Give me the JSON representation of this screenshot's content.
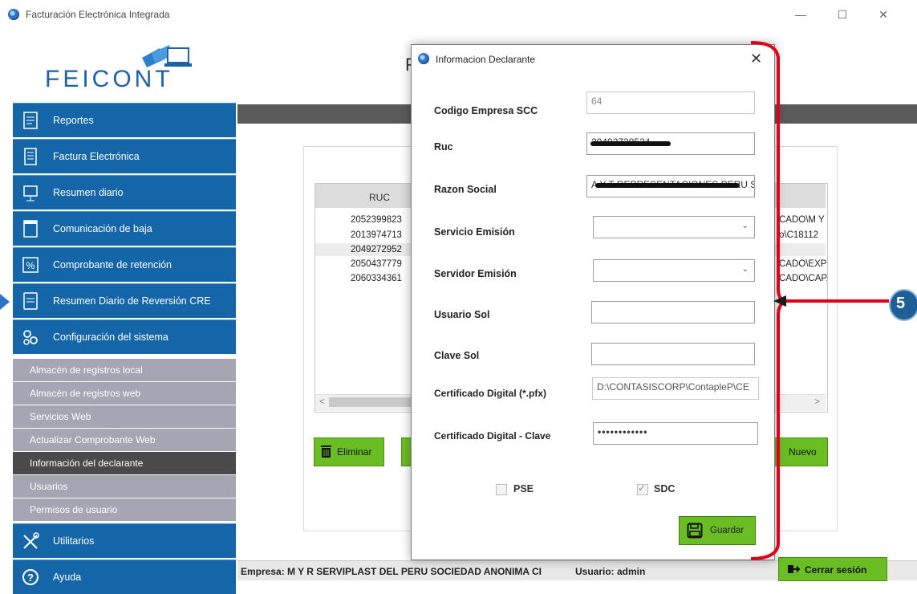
{
  "window": {
    "title": "Facturación Electrónica Integrada",
    "controls": {
      "minimize": "—",
      "maximize": "☐",
      "close": "✕"
    }
  },
  "logo": {
    "text": "FEICONT"
  },
  "sidebar": {
    "items": [
      {
        "label": "Reportes",
        "icon": "report-icon"
      },
      {
        "label": "Factura Electrónica",
        "icon": "document-icon"
      },
      {
        "label": "Resumen diario",
        "icon": "calendar-icon"
      },
      {
        "label": "Comunicación de baja",
        "icon": "list-icon"
      },
      {
        "label": "Comprobante de retención",
        "icon": "percent-icon"
      },
      {
        "label": "Resumen Diario de Reversión CRE",
        "icon": "notebook-icon"
      },
      {
        "label": "Configuración del sistema",
        "icon": "gears-icon"
      }
    ],
    "subitems": [
      {
        "label": "Almacén de registros local"
      },
      {
        "label": "Almacén de registros web"
      },
      {
        "label": "Servicios Web"
      },
      {
        "label": "Actualizar Comprobante Web"
      },
      {
        "label": "Información del declarante",
        "active": true
      },
      {
        "label": "Usuarios"
      },
      {
        "label": "Permisos de usuario"
      }
    ],
    "bottom_items": [
      {
        "label": "Utilitarios",
        "icon": "tools-icon"
      },
      {
        "label": "Ayuda",
        "icon": "help-icon"
      }
    ]
  },
  "content": {
    "title_partial": "F",
    "grid": {
      "header_ruc": "RUC",
      "rows_ruc": [
        "2052399823",
        "2013974713",
        "2049272952",
        "2050437779",
        "2060334361"
      ],
      "rows_right": [
        "CADO\\M Y",
        "o\\C18112",
        "",
        "CADO\\EXPO",
        "CADO\\CAPA"
      ],
      "scroll_left": "<",
      "scroll_right": ">"
    },
    "buttons": {
      "eliminar": "Eliminar",
      "nuevo": "Nuevo"
    }
  },
  "statusbar": {
    "empresa": "Empresa: M Y R SERVIPLAST DEL PERU SOCIEDAD ANONIMA CI",
    "usuario": "Usuario: admin",
    "cerrar": "Cerrar sesión"
  },
  "dialog": {
    "title": "Informacion Declarante",
    "close": "✕",
    "fields": {
      "codigo_label": "Codigo Empresa SCC",
      "codigo_value": "64",
      "ruc_label": "Ruc",
      "ruc_value": "20492729524",
      "razon_label": "Razon Social",
      "razon_value": "A Y T REPRESENTACIONES PERU S",
      "servicio_label": "Servicio Emisión",
      "servicio_value": "",
      "servidor_label": "Servidor Emisión",
      "servidor_value": "",
      "usuario_label": "Usuario Sol",
      "usuario_value": "",
      "clave_label": "Clave Sol",
      "clave_value": "",
      "cert_label": "Certificado Digital (*.pfx)",
      "cert_value": "D:\\CONTASISCORP\\ContapleP\\CE",
      "cert_clave_label": "Certificado Digital - Clave",
      "cert_clave_value": "••••••••••••"
    },
    "checkboxes": {
      "pse": "PSE",
      "sdc": "SDC",
      "pse_checked": false,
      "sdc_checked": true
    },
    "save_label": "Guardar"
  },
  "annotation": {
    "badge": "5"
  },
  "colors": {
    "nav_blue": "#1466a8",
    "sub_gray": "#a6a5b4",
    "green": "#6bbd24",
    "annotation_red": "#e0001b",
    "badge_blue": "#1f5f97"
  }
}
